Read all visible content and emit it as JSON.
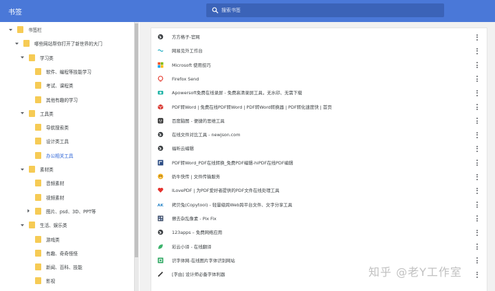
{
  "header": {
    "app_title": "书签",
    "search_placeholder": "搜索书签",
    "accent_color": "#4a78d8"
  },
  "sidebar": {
    "items": [
      {
        "label": "书签栏",
        "level": 0,
        "expanded": true,
        "has_children": true,
        "selected": false
      },
      {
        "label": "哪些网站帮你打开了新世界的大门",
        "level": 1,
        "expanded": true,
        "has_children": true,
        "selected": false
      },
      {
        "label": "学习类",
        "level": 2,
        "expanded": true,
        "has_children": true,
        "selected": false
      },
      {
        "label": "软件、编程等技能学习",
        "level": 3,
        "expanded": false,
        "has_children": false,
        "selected": false
      },
      {
        "label": "考试、课程类",
        "level": 3,
        "expanded": false,
        "has_children": false,
        "selected": false
      },
      {
        "label": "其他有趣的学习",
        "level": 3,
        "expanded": false,
        "has_children": false,
        "selected": false
      },
      {
        "label": "工具类",
        "level": 2,
        "expanded": true,
        "has_children": true,
        "selected": false
      },
      {
        "label": "导航搜索类",
        "level": 3,
        "expanded": false,
        "has_children": false,
        "selected": false
      },
      {
        "label": "设计类工具",
        "level": 3,
        "expanded": false,
        "has_children": false,
        "selected": false
      },
      {
        "label": "办公相关工具",
        "level": 3,
        "expanded": false,
        "has_children": false,
        "selected": true
      },
      {
        "label": "素材类",
        "level": 2,
        "expanded": true,
        "has_children": true,
        "selected": false
      },
      {
        "label": "音频素材",
        "level": 3,
        "expanded": false,
        "has_children": false,
        "selected": false
      },
      {
        "label": "视频素材",
        "level": 3,
        "expanded": false,
        "has_children": false,
        "selected": false
      },
      {
        "label": "图片、psd、3D、PPT等",
        "level": 3,
        "expanded": false,
        "has_children": true,
        "selected": false
      },
      {
        "label": "生活、娱乐类",
        "level": 2,
        "expanded": true,
        "has_children": true,
        "selected": false
      },
      {
        "label": "游戏类",
        "level": 3,
        "expanded": false,
        "has_children": false,
        "selected": false
      },
      {
        "label": "有趣、奇奇怪怪",
        "level": 3,
        "expanded": false,
        "has_children": false,
        "selected": false
      },
      {
        "label": "新闻、百科、技能",
        "level": 3,
        "expanded": false,
        "has_children": false,
        "selected": false
      },
      {
        "label": "影视",
        "level": 3,
        "expanded": false,
        "has_children": false,
        "selected": false
      }
    ]
  },
  "bookmarks": [
    {
      "title": "方方格子-官网",
      "icon": "globe-icon",
      "icon_color": "#3c4043"
    },
    {
      "title": "网易见外工作台",
      "icon": "wave-icon",
      "icon_color": "#2ab0c5"
    },
    {
      "title": "Microsoft 使用技巧",
      "icon": "microsoft-icon",
      "icon_color": "#f25022"
    },
    {
      "title": "Firefox Send",
      "icon": "firefox-send-icon",
      "icon_color": "#e6453a"
    },
    {
      "title": "Apowersoft免费在线录屏 - 免费高清录屏工具，无水印、无需下载",
      "icon": "camera-icon",
      "icon_color": "#1fb3a6"
    },
    {
      "title": "PDF转Word | 免费在线PDF转Word | PDF转Word转换器 | PDF转化速度快 | 首页",
      "icon": "cube-icon",
      "icon_color": "#d93b34"
    },
    {
      "title": "百度脑图 - 便捷的思维工具",
      "icon": "brain-icon",
      "icon_color": "#2d2d2d"
    },
    {
      "title": "在线文件对比工具 - newjson.com",
      "icon": "globe-icon",
      "icon_color": "#3c4043"
    },
    {
      "title": "福昕云编辑",
      "icon": "globe-icon",
      "icon_color": "#3c4043"
    },
    {
      "title": "PDF转Word_PDF在线转换_免费PDF编辑-hiPDF在线PDF编辑",
      "icon": "hipdf-icon",
      "icon_color": "#1d3f7a"
    },
    {
      "title": "奶牛快传 | 文件传输服务",
      "icon": "cow-icon",
      "icon_color": "#f2b01e"
    },
    {
      "title": "ILovePDF | 为PDF爱好者提供的PDF文件在线处理工具",
      "icon": "heart-icon",
      "icon_color": "#e5322d"
    },
    {
      "title": "拷贝兔(Copytool) - 轻量级跨Web跨平台文件、文字分享工具",
      "icon": "ak-icon",
      "icon_color": "#2a86c8"
    },
    {
      "title": "擦去杂乱像素 - Pix Fix",
      "icon": "grid-icon",
      "icon_color": "#2b3a55"
    },
    {
      "title": "123apps – 免费网络应用",
      "icon": "globe-icon",
      "icon_color": "#3c4043"
    },
    {
      "title": "彩云小译 - 在线翻译",
      "icon": "leaf-icon",
      "icon_color": "#3bb36b"
    },
    {
      "title": "识字体网-在线图片字体识别网站",
      "icon": "font-icon",
      "icon_color": "#23a35a"
    },
    {
      "title": "[字由] 设计师必备字体利器",
      "icon": "pen-icon",
      "icon_color": "#333333"
    }
  ],
  "watermark": "知乎 @老Y工作室"
}
